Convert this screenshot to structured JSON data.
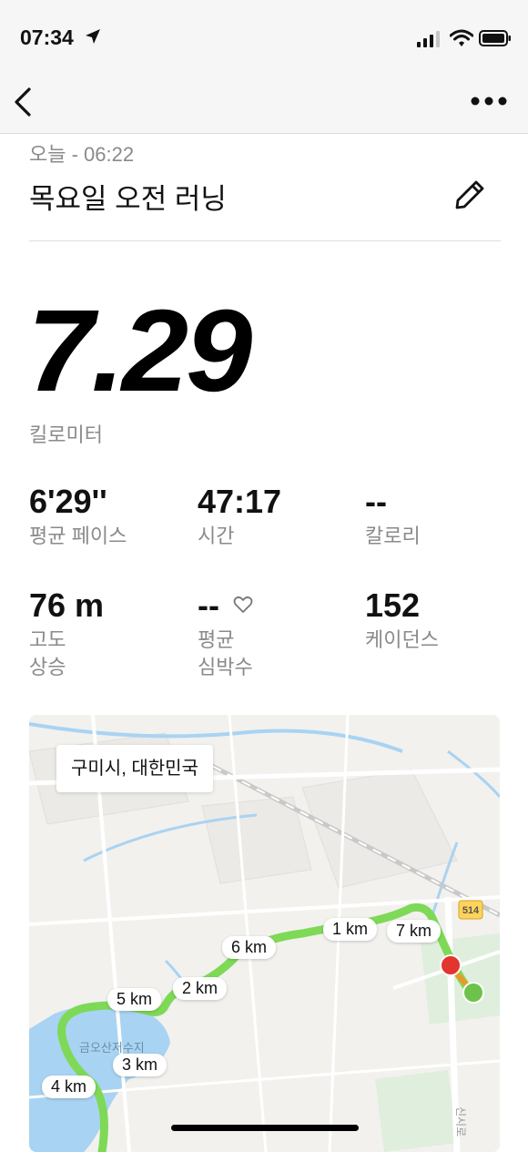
{
  "status_bar": {
    "time": "07:34"
  },
  "activity": {
    "date": "오늘 - 06:22",
    "title": "목요일 오전 러닝"
  },
  "distance": {
    "value": "7.29",
    "unit": "킬로미터"
  },
  "stats": [
    {
      "value": "6'29''",
      "label": "평균 페이스"
    },
    {
      "value": "47:17",
      "label": "시간"
    },
    {
      "value": "--",
      "label": "칼로리"
    },
    {
      "value": "76 m",
      "label_line1": "고도",
      "label_line2": "상승"
    },
    {
      "value": "--",
      "label_line1": "평균",
      "label_line2": "심박수"
    },
    {
      "value": "152",
      "label": "케이던스"
    }
  ],
  "map": {
    "location": "구미시, 대한민국",
    "route_color": "#7ed957",
    "start_color": "#e3342f",
    "end_color": "#6cc24a",
    "road_badge": "514",
    "lake_label": "금오산저수지",
    "road_label": "신시로",
    "km_markers": [
      "1 km",
      "2 km",
      "3 km",
      "4 km",
      "5 km",
      "6 km",
      "7 km"
    ]
  }
}
